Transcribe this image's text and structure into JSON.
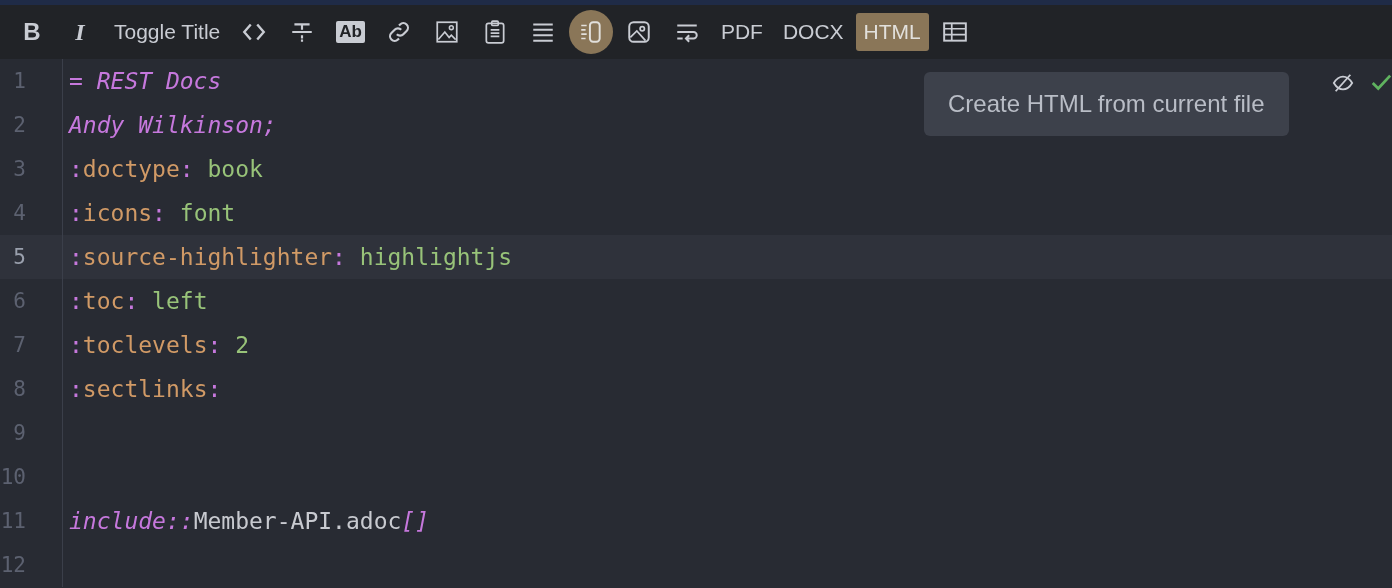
{
  "toolbar": [
    {
      "kind": "bold",
      "label": "B",
      "selected": false
    },
    {
      "kind": "italic",
      "label": "I",
      "selected": false
    },
    {
      "kind": "text",
      "label": "Toggle Title",
      "selected": false
    },
    {
      "kind": "code",
      "selected": false
    },
    {
      "kind": "strike",
      "selected": false
    },
    {
      "kind": "highlight",
      "label": "Ab",
      "selected": false
    },
    {
      "kind": "link",
      "selected": false
    },
    {
      "kind": "image",
      "selected": false
    },
    {
      "kind": "clipboard",
      "selected": false
    },
    {
      "kind": "list",
      "selected": false
    },
    {
      "kind": "preview",
      "selected": true
    },
    {
      "kind": "picture-frame",
      "selected": false
    },
    {
      "kind": "wrap",
      "selected": false
    },
    {
      "kind": "text",
      "label": "PDF",
      "selected": false
    },
    {
      "kind": "text",
      "label": "DOCX",
      "selected": false
    },
    {
      "kind": "text",
      "label": "HTML",
      "selected": true
    },
    {
      "kind": "table",
      "selected": false
    }
  ],
  "tooltip": "Create HTML from current file",
  "editor": {
    "lines": [
      {
        "number": "1",
        "current": false,
        "tokens": [
          {
            "kind": "heading",
            "text": "= REST Docs"
          }
        ]
      },
      {
        "number": "2",
        "current": false,
        "tokens": [
          {
            "kind": "heading",
            "text": "Andy Wilkinson;"
          }
        ]
      },
      {
        "number": "3",
        "current": false,
        "tokens": [
          {
            "kind": "punct",
            "text": ":"
          },
          {
            "kind": "attr",
            "text": "doctype"
          },
          {
            "kind": "punct",
            "text": ":"
          },
          {
            "kind": "value",
            "text": " book"
          }
        ]
      },
      {
        "number": "4",
        "current": false,
        "tokens": [
          {
            "kind": "punct",
            "text": ":"
          },
          {
            "kind": "attr",
            "text": "icons"
          },
          {
            "kind": "punct",
            "text": ":"
          },
          {
            "kind": "value",
            "text": " font"
          }
        ]
      },
      {
        "number": "5",
        "current": true,
        "tokens": [
          {
            "kind": "punct",
            "text": ":"
          },
          {
            "kind": "attr",
            "text": "source-highlighter"
          },
          {
            "kind": "punct",
            "text": ":"
          },
          {
            "kind": "value",
            "text": " highlightjs"
          }
        ]
      },
      {
        "number": "6",
        "current": false,
        "tokens": [
          {
            "kind": "punct",
            "text": ":"
          },
          {
            "kind": "attr",
            "text": "toc"
          },
          {
            "kind": "punct",
            "text": ":"
          },
          {
            "kind": "value",
            "text": " left"
          }
        ]
      },
      {
        "number": "7",
        "current": false,
        "tokens": [
          {
            "kind": "punct",
            "text": ":"
          },
          {
            "kind": "attr",
            "text": "toclevels"
          },
          {
            "kind": "punct",
            "text": ":"
          },
          {
            "kind": "value",
            "text": " 2"
          }
        ]
      },
      {
        "number": "8",
        "current": false,
        "tokens": [
          {
            "kind": "punct",
            "text": ":"
          },
          {
            "kind": "attr",
            "text": "sectlinks"
          },
          {
            "kind": "punct",
            "text": ":"
          }
        ]
      },
      {
        "number": "9",
        "current": false
      },
      {
        "number": "10",
        "current": false
      },
      {
        "number": "11",
        "current": false,
        "tokens": [
          {
            "kind": "macro",
            "text": "include::"
          },
          {
            "kind": "text",
            "text": "Member-API.adoc"
          },
          {
            "kind": "macro",
            "text": "[]"
          }
        ]
      },
      {
        "number": "12",
        "current": false
      }
    ]
  }
}
